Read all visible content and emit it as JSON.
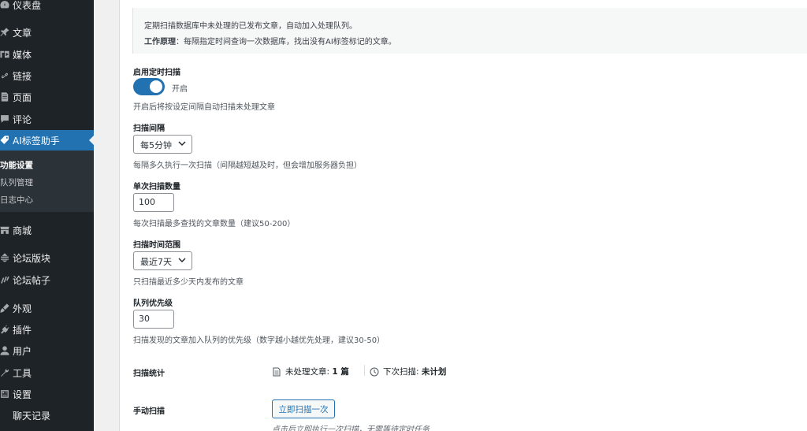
{
  "sidebar": {
    "items": [
      {
        "label": "仪表盘",
        "icon": "dashboard-icon"
      },
      {
        "label": "文章",
        "icon": "pin-icon"
      },
      {
        "label": "媒体",
        "icon": "media-icon"
      },
      {
        "label": "链接",
        "icon": "link-icon"
      },
      {
        "label": "页面",
        "icon": "page-icon"
      },
      {
        "label": "评论",
        "icon": "comment-icon"
      },
      {
        "label": "AI标签助手",
        "icon": "tag-icon"
      },
      {
        "label": "商城",
        "icon": "store-icon"
      },
      {
        "label": "论坛版块",
        "icon": "forum-icon"
      },
      {
        "label": "论坛帖子",
        "icon": "forum-post-icon"
      },
      {
        "label": "外观",
        "icon": "appearance-icon"
      },
      {
        "label": "插件",
        "icon": "plugin-icon"
      },
      {
        "label": "用户",
        "icon": "user-icon"
      },
      {
        "label": "工具",
        "icon": "wrench-icon"
      },
      {
        "label": "设置",
        "icon": "settings-icon"
      },
      {
        "label": "聊天记录",
        "icon": ""
      }
    ],
    "submenu": [
      {
        "label": "功能设置"
      },
      {
        "label": "队列管理"
      },
      {
        "label": "日志中心"
      }
    ]
  },
  "notice": {
    "line1": "定期扫描数据库中未处理的已发布文章，自动加入处理队列。",
    "line2_label": "工作原理",
    "line2_text": "：每隔指定时间查询一次数据库，找出没有AI标签标记的文章。"
  },
  "form": {
    "enable": {
      "label": "启用定时扫描",
      "state": "开启",
      "desc": "开启后将按设定间隔自动扫描未处理文章"
    },
    "interval": {
      "label": "扫描间隔",
      "value": "每5分钟",
      "desc": "每隔多久执行一次扫描（间隔越短越及时，但会增加服务器负担）"
    },
    "batch": {
      "label": "单次扫描数量",
      "value": "100",
      "desc": "每次扫描最多查找的文章数量（建议50-200）"
    },
    "range": {
      "label": "扫描时间范围",
      "value": "最近7天",
      "desc": "只扫描最近多少天内发布的文章"
    },
    "priority": {
      "label": "队列优先级",
      "value": "30",
      "desc": "扫描发现的文章加入队列的优先级（数字越小越优先处理，建议30-50）"
    }
  },
  "stats": {
    "label": "扫描统计",
    "unprocessed_label": "未处理文章:",
    "unprocessed_value": "1 篇",
    "next_label": "下次扫描:",
    "next_value": "未计划"
  },
  "manual": {
    "label": "手动扫描",
    "button": "立即扫描一次",
    "hint": "点击后立即执行一次扫描，无需等待定时任务"
  },
  "colors": {
    "accent": "#2271b1",
    "sidebar_bg": "#1d2327"
  }
}
